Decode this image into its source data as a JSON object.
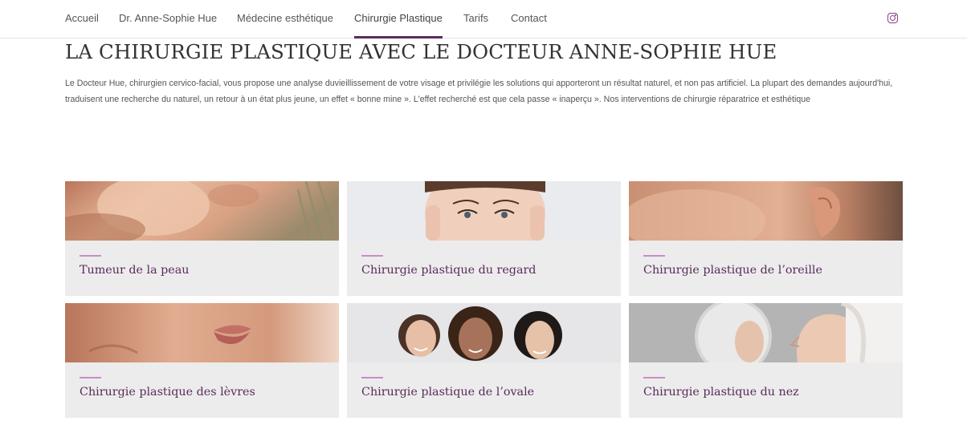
{
  "nav": {
    "items": [
      {
        "label": "Accueil"
      },
      {
        "label": "Dr. Anne-Sophie Hue"
      },
      {
        "label": "Médecine esthétique"
      },
      {
        "label": "Chirurgie Plastique"
      },
      {
        "label": "Tarifs"
      },
      {
        "label": "Contact"
      }
    ],
    "active_index": 3,
    "social_icon": "instagram-icon",
    "accent_color": "#5c2a5e"
  },
  "page": {
    "title": "LA CHIRURGIE PLASTIQUE AVEC LE DOCTEUR ANNE-SOPHIE HUE",
    "intro": "Le Docteur Hue, chirurgien cervico-facial, vous propose une analyse duvieillissement de votre visage et privilégie les solutions qui apporteront un résultat naturel, et non pas artificiel. La plupart des demandes aujourd'hui, traduisent une recherche du naturel, un retour à un état plus jeune, un effet « bonne mine ». L'effet recherché est que cela passe « inaperçu ». Nos interventions de chirurgie réparatrice et esthétique"
  },
  "cards": [
    {
      "title": "Tumeur de la peau",
      "image": "face-closeup-photo"
    },
    {
      "title": "Chirurgie plastique du regard",
      "image": "eyes-photo"
    },
    {
      "title": "Chirurgie plastique de l’oreille",
      "image": "ear-photo"
    },
    {
      "title": "Chirurgie plastique des lèvres",
      "image": "lips-photo"
    },
    {
      "title": "Chirurgie plastique de l’ovale",
      "image": "women-group-photo"
    },
    {
      "title": "Chirurgie plastique du nez",
      "image": "mirror-profile-photo"
    }
  ],
  "colors": {
    "card_background": "#ececec",
    "card_accent": "#c98bc8",
    "card_title": "#5a2a5c"
  }
}
